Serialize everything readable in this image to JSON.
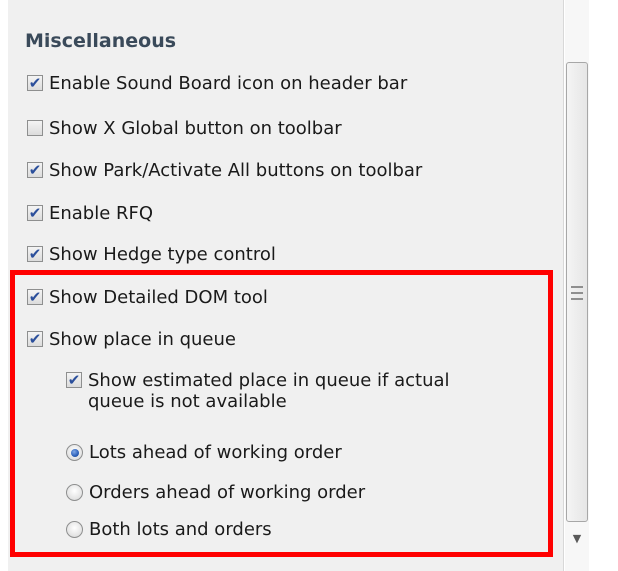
{
  "section": {
    "title": "Miscellaneous"
  },
  "options": [
    {
      "label": "Enable Sound Board icon on header bar",
      "checked": true
    },
    {
      "label": "Show X Global button on toolbar",
      "checked": false
    },
    {
      "label": "Show Park/Activate All buttons on toolbar",
      "checked": true
    },
    {
      "label": "Enable RFQ",
      "checked": true
    },
    {
      "label": "Show Hedge type control",
      "checked": true
    },
    {
      "label": "Show Detailed DOM tool",
      "checked": true
    },
    {
      "label": "Show place in queue",
      "checked": true
    }
  ],
  "queue_options": {
    "estimated": {
      "label": "Show estimated place in queue if actual queue is not available",
      "checked": true
    },
    "radios": [
      {
        "label": "Lots ahead of working order",
        "selected": true
      },
      {
        "label": "Orders ahead of working order",
        "selected": false
      },
      {
        "label": "Both lots and orders",
        "selected": false
      }
    ]
  },
  "colors": {
    "highlight": "#ff0000",
    "check": "#2b4f9b",
    "title": "#3a4a5a"
  }
}
